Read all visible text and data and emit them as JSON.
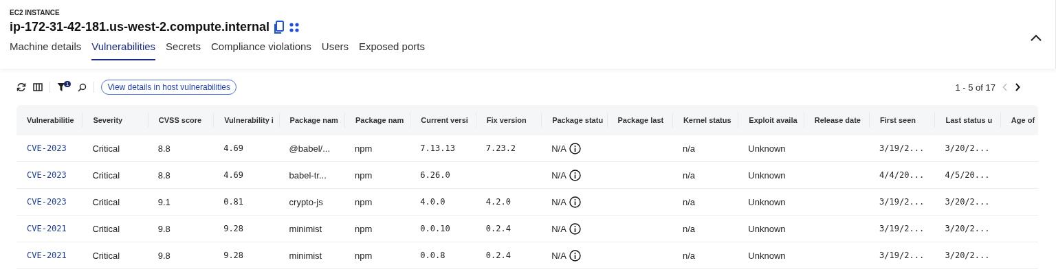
{
  "header": {
    "overline": "EC2 INSTANCE",
    "title": "ip-172-31-42-181.us-west-2.compute.internal"
  },
  "tabs": [
    {
      "label": "Machine details",
      "selected": false
    },
    {
      "label": "Vulnerabilities",
      "selected": true
    },
    {
      "label": "Secrets",
      "selected": false
    },
    {
      "label": "Compliance violations",
      "selected": false
    },
    {
      "label": "Users",
      "selected": false
    },
    {
      "label": "Exposed ports",
      "selected": false
    }
  ],
  "toolbar": {
    "filter_count": "1",
    "link_button": "View details in host vulnerabilities",
    "pagination": "1 - 5 of 17"
  },
  "table": {
    "columns": [
      {
        "label": "Vulnerabilitie",
        "kind": "link"
      },
      {
        "label": "Severity",
        "kind": "text"
      },
      {
        "label": "CVSS score",
        "kind": "text"
      },
      {
        "label": "Vulnerability i",
        "kind": "mono"
      },
      {
        "label": "Package nam",
        "kind": "text"
      },
      {
        "label": "Package nam",
        "kind": "text"
      },
      {
        "label": "Current versi",
        "kind": "mono"
      },
      {
        "label": "Fix version",
        "kind": "mono"
      },
      {
        "label": "Package statu",
        "kind": "status"
      },
      {
        "label": "Package last",
        "kind": "text"
      },
      {
        "label": "Kernel status",
        "kind": "text"
      },
      {
        "label": "Exploit availa",
        "kind": "text"
      },
      {
        "label": "Release date",
        "kind": "text"
      },
      {
        "label": "First seen",
        "kind": "mono"
      },
      {
        "label": "Last status u",
        "kind": "mono"
      },
      {
        "label": "Age of",
        "kind": "text"
      }
    ],
    "rows": [
      {
        "cells": [
          "CVE-2023",
          "Critical",
          "8.8",
          "4.69",
          "@babel/...",
          "npm",
          "7.13.13",
          "7.23.2",
          "N/A",
          null,
          "n/a",
          "Unknown",
          null,
          "3/19/2...",
          "3/20/2...",
          null
        ]
      },
      {
        "cells": [
          "CVE-2023",
          "Critical",
          "8.8",
          "4.69",
          "babel-tr...",
          "npm",
          "6.26.0",
          null,
          "N/A",
          null,
          "n/a",
          "Unknown",
          null,
          "4/4/20...",
          "4/5/20...",
          null
        ]
      },
      {
        "cells": [
          "CVE-2023",
          "Critical",
          "9.1",
          "0.81",
          "crypto-js",
          "npm",
          "4.0.0",
          "4.2.0",
          "N/A",
          null,
          "n/a",
          "Unknown",
          null,
          "3/19/2...",
          "3/20/2...",
          null
        ]
      },
      {
        "cells": [
          "CVE-2021",
          "Critical",
          "9.8",
          "9.28",
          "minimist",
          "npm",
          "0.0.10",
          "0.2.4",
          "N/A",
          null,
          "n/a",
          "Unknown",
          null,
          "3/19/2...",
          "3/20/2...",
          null
        ]
      },
      {
        "cells": [
          "CVE-2021",
          "Critical",
          "9.8",
          "9.28",
          "minimist",
          "npm",
          "0.0.8",
          "0.2.4",
          "N/A",
          null,
          "n/a",
          "Unknown",
          null,
          "3/19/2...",
          "3/20/2...",
          null
        ]
      }
    ]
  }
}
